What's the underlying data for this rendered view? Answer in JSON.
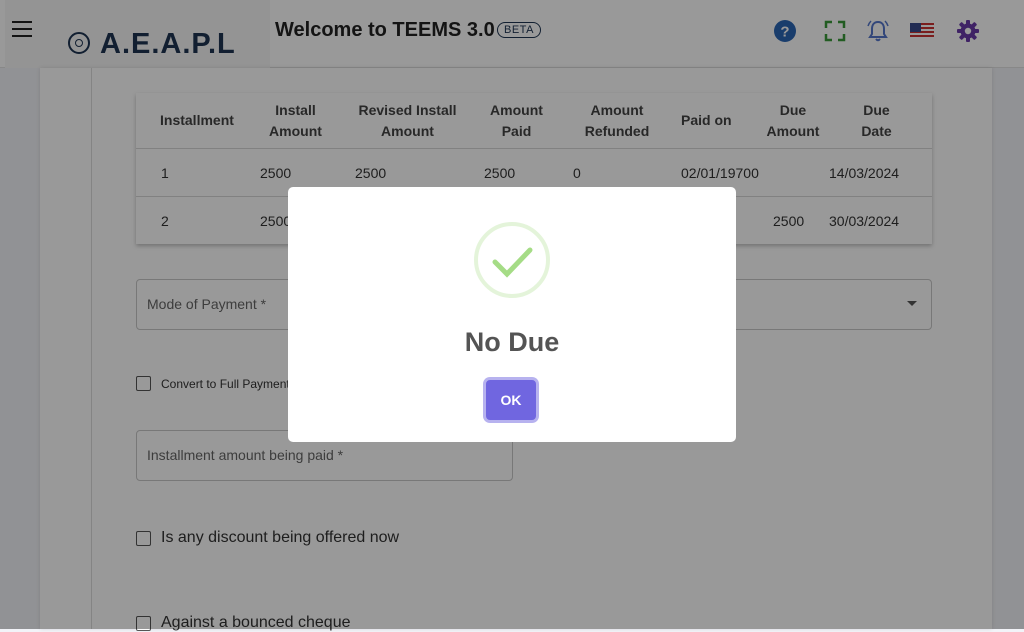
{
  "header": {
    "logo_text": "A.E.A.P.L",
    "welcome_text": "Welcome to TEEMS 3.0",
    "beta_badge": "BETA",
    "colors": {
      "help": "#2a66b5",
      "fullscreen": "#3a9a3a",
      "bell": "#5577cc",
      "gear": "#6a3aa8"
    }
  },
  "installments_table": {
    "columns": [
      "Installment",
      "Install Amount",
      "Revised Install Amount",
      "Amount Paid",
      "Amount Refunded",
      "Paid on",
      "Due Amount",
      "Due Date"
    ],
    "column_header_lines": [
      [
        "Installment"
      ],
      [
        "Install",
        "Amount"
      ],
      [
        "Revised Install",
        "Amount"
      ],
      [
        "Amount",
        "Paid"
      ],
      [
        "Amount",
        "Refunded"
      ],
      [
        "Paid on"
      ],
      [
        "Due",
        "Amount"
      ],
      [
        "Due",
        "Date"
      ]
    ],
    "rows": [
      [
        "1",
        "2500",
        "2500",
        "2500",
        "0",
        "02/01/19700",
        "",
        "14/03/2024"
      ],
      [
        "2",
        "2500",
        "",
        "",
        "",
        "",
        "2500",
        "30/03/2024"
      ]
    ]
  },
  "form": {
    "mode_of_payment_label": "Mode of Payment *",
    "convert_full_payment_label": "Convert to Full Payment",
    "installment_amount_label": "Installment amount being paid *",
    "discount_label": "Is any discount being offered now",
    "bounced_cheque_label": "Against a bounced cheque"
  },
  "modal": {
    "title": "No Due",
    "ok_label": "OK",
    "icon": "success-check-icon",
    "check_color": "#a5dc86",
    "button_color": "#7066e0"
  }
}
